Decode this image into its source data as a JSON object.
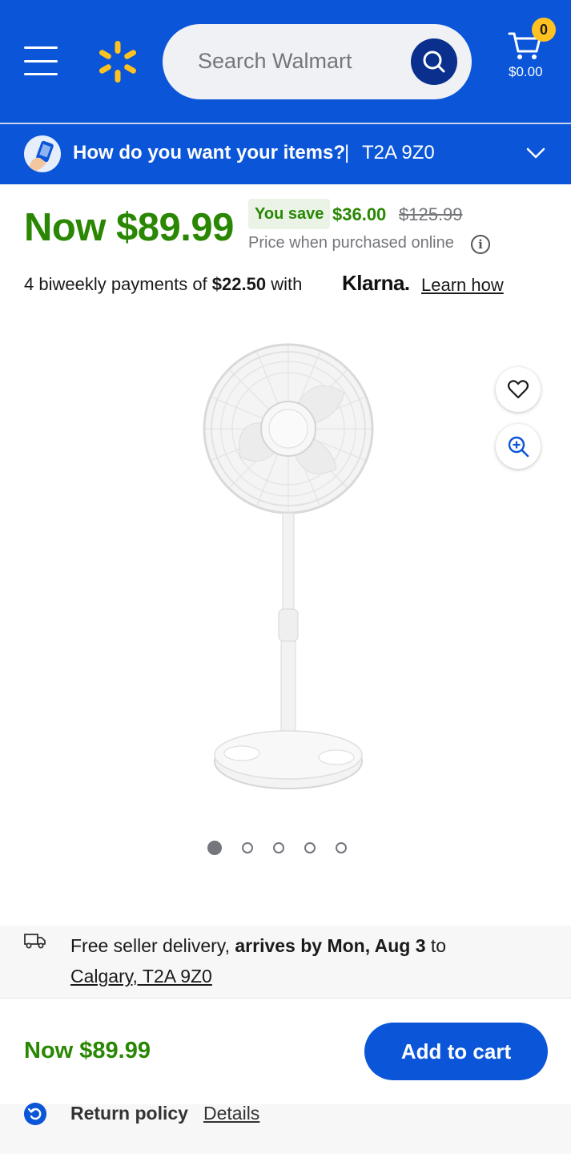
{
  "header": {
    "search_placeholder": "Search Walmart",
    "cart_count": "0",
    "cart_total": "$0.00",
    "brand_color": "#0a55d8",
    "spark_color": "#ffc220"
  },
  "delivery_bar": {
    "question": "How do you want your items?",
    "separator": "|",
    "zip": "T2A 9Z0"
  },
  "pricing": {
    "now_price": "Now $89.99",
    "you_save_label": "You save",
    "save_amount": "$36.00",
    "was_price": "$125.99",
    "price_note": "Price when purchased online",
    "price_color": "#2a8703"
  },
  "klarna": {
    "prefix": "4 biweekly payments of ",
    "amount": "$22.50",
    "suffix": " with",
    "brand": "Klarna.",
    "learn_link": "Learn how"
  },
  "gallery": {
    "image_count": 5,
    "active_index": 0,
    "product_image": "white pedestal stand fan"
  },
  "fulfillment": {
    "text_prefix": "Free seller delivery, ",
    "arrival": "arrives by Mon, Aug 3",
    "text_to": " to",
    "location": "Calgary, T2A 9Z0"
  },
  "bottom_bar": {
    "price": "Now $89.99",
    "add_to_cart": "Add to cart"
  },
  "return_policy": {
    "label": "Return policy",
    "details_link": "Details"
  }
}
